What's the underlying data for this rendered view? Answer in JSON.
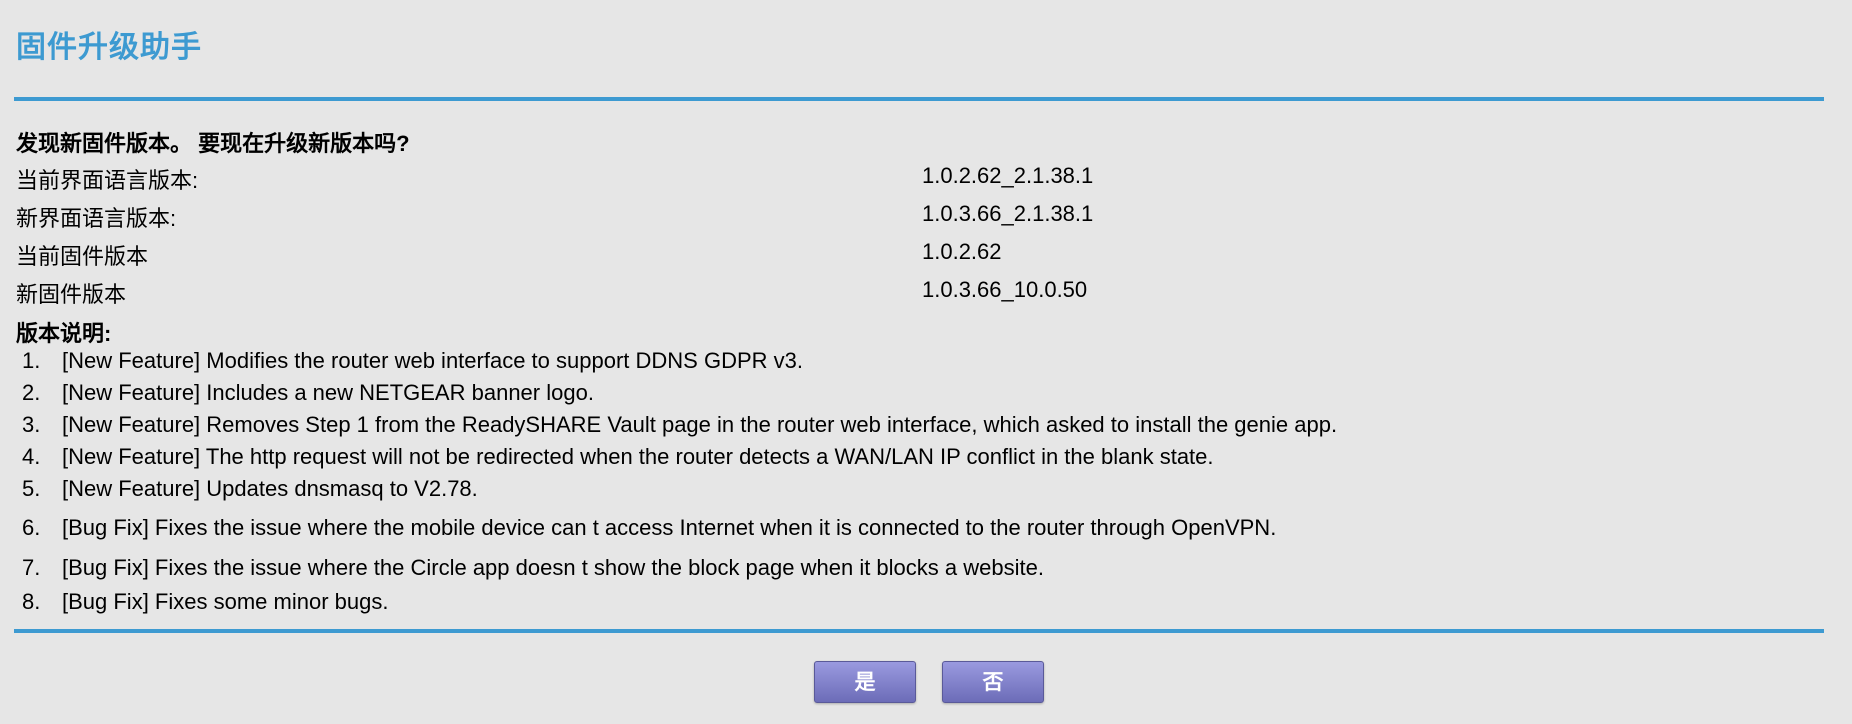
{
  "page": {
    "title": "固件升级助手",
    "question": "发现新固件版本。 要现在升级新版本吗?"
  },
  "info": [
    {
      "label": "当前界面语言版本:",
      "value": "1.0.2.62_2.1.38.1"
    },
    {
      "label": "新界面语言版本:",
      "value": "1.0.3.66_2.1.38.1"
    },
    {
      "label": "当前固件版本",
      "value": "1.0.2.62"
    },
    {
      "label": "新固件版本",
      "value": "1.0.3.66_10.0.50"
    }
  ],
  "notes": {
    "heading": "版本说明:",
    "items": [
      {
        "num": "1.",
        "text": "[New Feature] Modifies the router web interface to support DDNS GDPR v3."
      },
      {
        "num": "2.",
        "text": "[New Feature] Includes a new NETGEAR banner logo."
      },
      {
        "num": "3.",
        "text": "[New Feature] Removes Step 1 from the ReadySHARE Vault page in the router web interface, which asked to install the genie app."
      },
      {
        "num": "4.",
        "text": "[New Feature] The http request will not be redirected when the router detects a WAN/LAN IP conflict in the blank state."
      },
      {
        "num": "5.",
        "text": "[New Feature] Updates dnsmasq to V2.78."
      },
      {
        "num": "6.",
        "text": "[Bug Fix] Fixes the issue where the mobile device can  t access Internet when it is connected to the router through OpenVPN."
      },
      {
        "num": "7.",
        "text": "[Bug Fix] Fixes the issue where the Circle app doesn  t show the block page when it blocks a website."
      },
      {
        "num": "8.",
        "text": "[Bug Fix] Fixes some minor bugs."
      }
    ]
  },
  "buttons": {
    "yes": "是",
    "no": "否"
  },
  "colors": {
    "accent": "#3d9ad1",
    "background": "#e6e6e6",
    "button": "#7d7dc9"
  }
}
